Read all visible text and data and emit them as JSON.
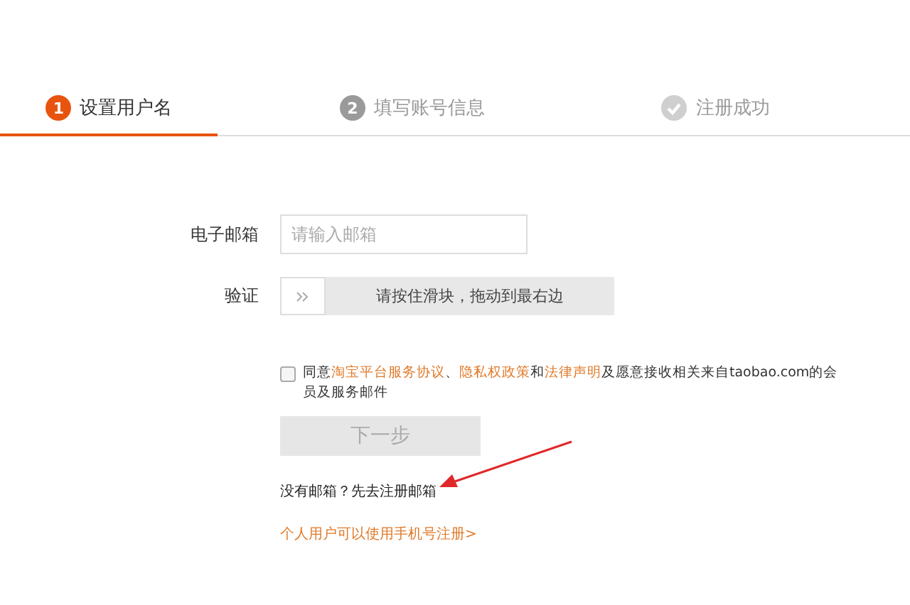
{
  "steps": [
    {
      "kind": "number",
      "number": "1",
      "label": "设置用户名",
      "selected": true
    },
    {
      "kind": "number",
      "number": "2",
      "label": "填写账号信息",
      "selected": false
    },
    {
      "kind": "check",
      "label": "注册成功",
      "selected": false
    }
  ],
  "form": {
    "email_label": "电子邮箱",
    "email_placeholder": "请输入邮箱",
    "verify_label": "验证",
    "slider_hint": "请按住滑块，拖动到最右边"
  },
  "agreement": {
    "checked": false,
    "parts": [
      {
        "kind": "text",
        "text": "同意"
      },
      {
        "kind": "link",
        "text": "淘宝平台服务协议"
      },
      {
        "kind": "text",
        "text": "、"
      },
      {
        "kind": "link",
        "text": "隐私权政策"
      },
      {
        "kind": "text",
        "text": "和"
      },
      {
        "kind": "link",
        "text": "法律声明"
      },
      {
        "kind": "text",
        "text": "及愿意接收相关来自taobao.com的会员及服务邮件"
      }
    ]
  },
  "next_button": {
    "label": "下一步",
    "disabled": true
  },
  "no_email_link": "没有邮箱？先去注册邮箱",
  "phone_link": "个人用户可以使用手机号注册>"
}
